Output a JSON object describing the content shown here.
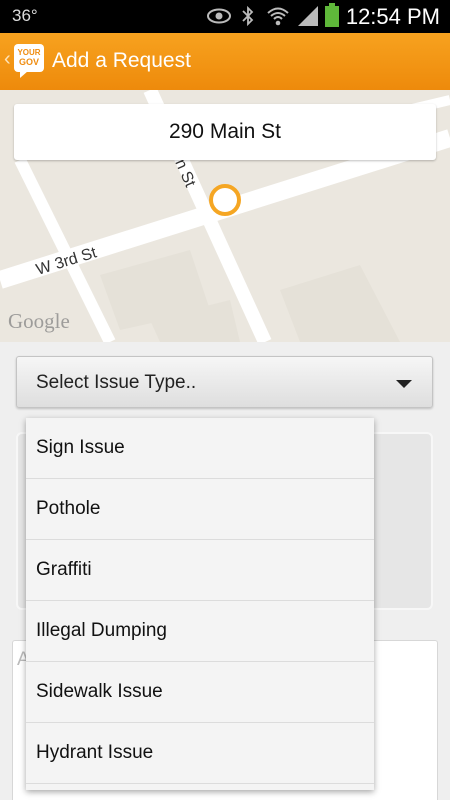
{
  "status_bar": {
    "temperature": "36°",
    "time": "12:54 PM",
    "icons": [
      "eye-icon",
      "bluetooth-icon",
      "wifi-icon",
      "signal-icon",
      "battery-icon"
    ]
  },
  "app_bar": {
    "back_glyph": "‹",
    "logo_text_top": "YOUR",
    "logo_text_bottom": "GOV",
    "title": "Add a Request"
  },
  "map": {
    "address": "290 Main St",
    "street_labels": [
      "W 3rd St",
      "n St"
    ],
    "attribution": "Google"
  },
  "issue_select": {
    "label": "Select Issue Type.."
  },
  "description": {
    "placeholder_fragment": "A"
  },
  "dropdown": {
    "options": [
      "Sign Issue",
      "Pothole",
      "Graffiti",
      "Illegal Dumping",
      "Sidewalk Issue",
      "Hydrant Issue"
    ]
  },
  "colors": {
    "accent": "#ef8c10",
    "marker": "#f5a623"
  }
}
